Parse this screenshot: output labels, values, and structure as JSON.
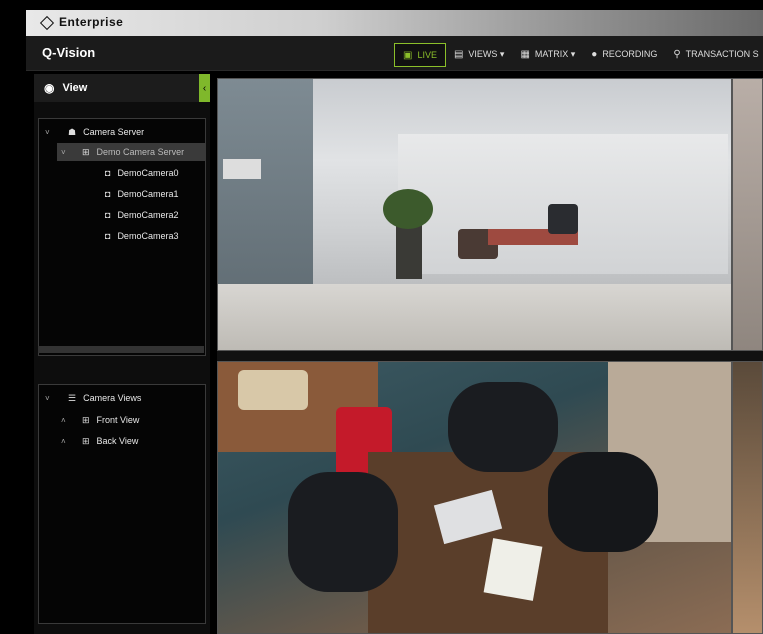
{
  "brand": {
    "name": "Enterprise"
  },
  "app": {
    "title": "Q-Vision"
  },
  "nav": [
    {
      "label": "LIVE",
      "icon": "live-icon",
      "active": true
    },
    {
      "label": "VIEWS ▾",
      "icon": "views-icon"
    },
    {
      "label": "MATRIX ▾",
      "icon": "matrix-icon"
    },
    {
      "label": "RECORDING",
      "icon": "record-dot-icon"
    },
    {
      "label": "TRANSACTION S",
      "icon": "search-icon"
    }
  ],
  "panel": {
    "header": "View",
    "collapse_glyph": "‹",
    "tree": {
      "server": "Camera Server",
      "demo_server": "Demo Camera Server",
      "cameras": [
        "DemoCamera0",
        "DemoCamera1",
        "DemoCamera2",
        "DemoCamera3"
      ]
    },
    "views": {
      "title": "Camera Views",
      "items": [
        "Front View",
        "Back View"
      ]
    }
  },
  "colors": {
    "accent": "#8bbf2a",
    "collapse": "#7fb82b"
  }
}
